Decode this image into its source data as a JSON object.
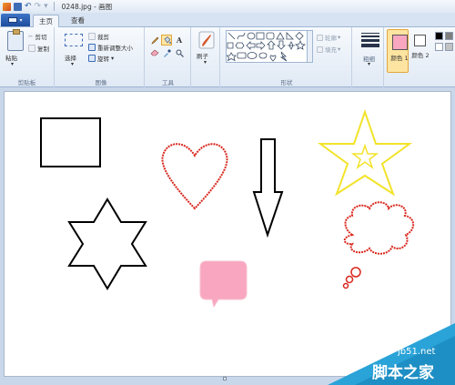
{
  "window": {
    "title": "0248.jpg - 画图"
  },
  "tabs": {
    "home": "主页",
    "view": "查看"
  },
  "clipboard": {
    "paste": "粘贴",
    "cut": "剪切",
    "copy": "复制",
    "label": "剪贴板"
  },
  "image": {
    "select": "选择",
    "crop": "裁剪",
    "resize": "重新调整大小",
    "rotate": "旋转",
    "label": "图像"
  },
  "tools": {
    "label": "工具"
  },
  "brushes": {
    "label": "刷子"
  },
  "shapes": {
    "outline": "轮廓",
    "fill": "填充",
    "label": "形状"
  },
  "size": {
    "label": "粗细"
  },
  "colors": {
    "color1": "颜色 1",
    "color2": "颜色 2",
    "color1_value": "#f9a7c0",
    "color2_value": "#ffffff"
  },
  "watermark": {
    "site": "jb51.net",
    "name": "脚本之家"
  }
}
